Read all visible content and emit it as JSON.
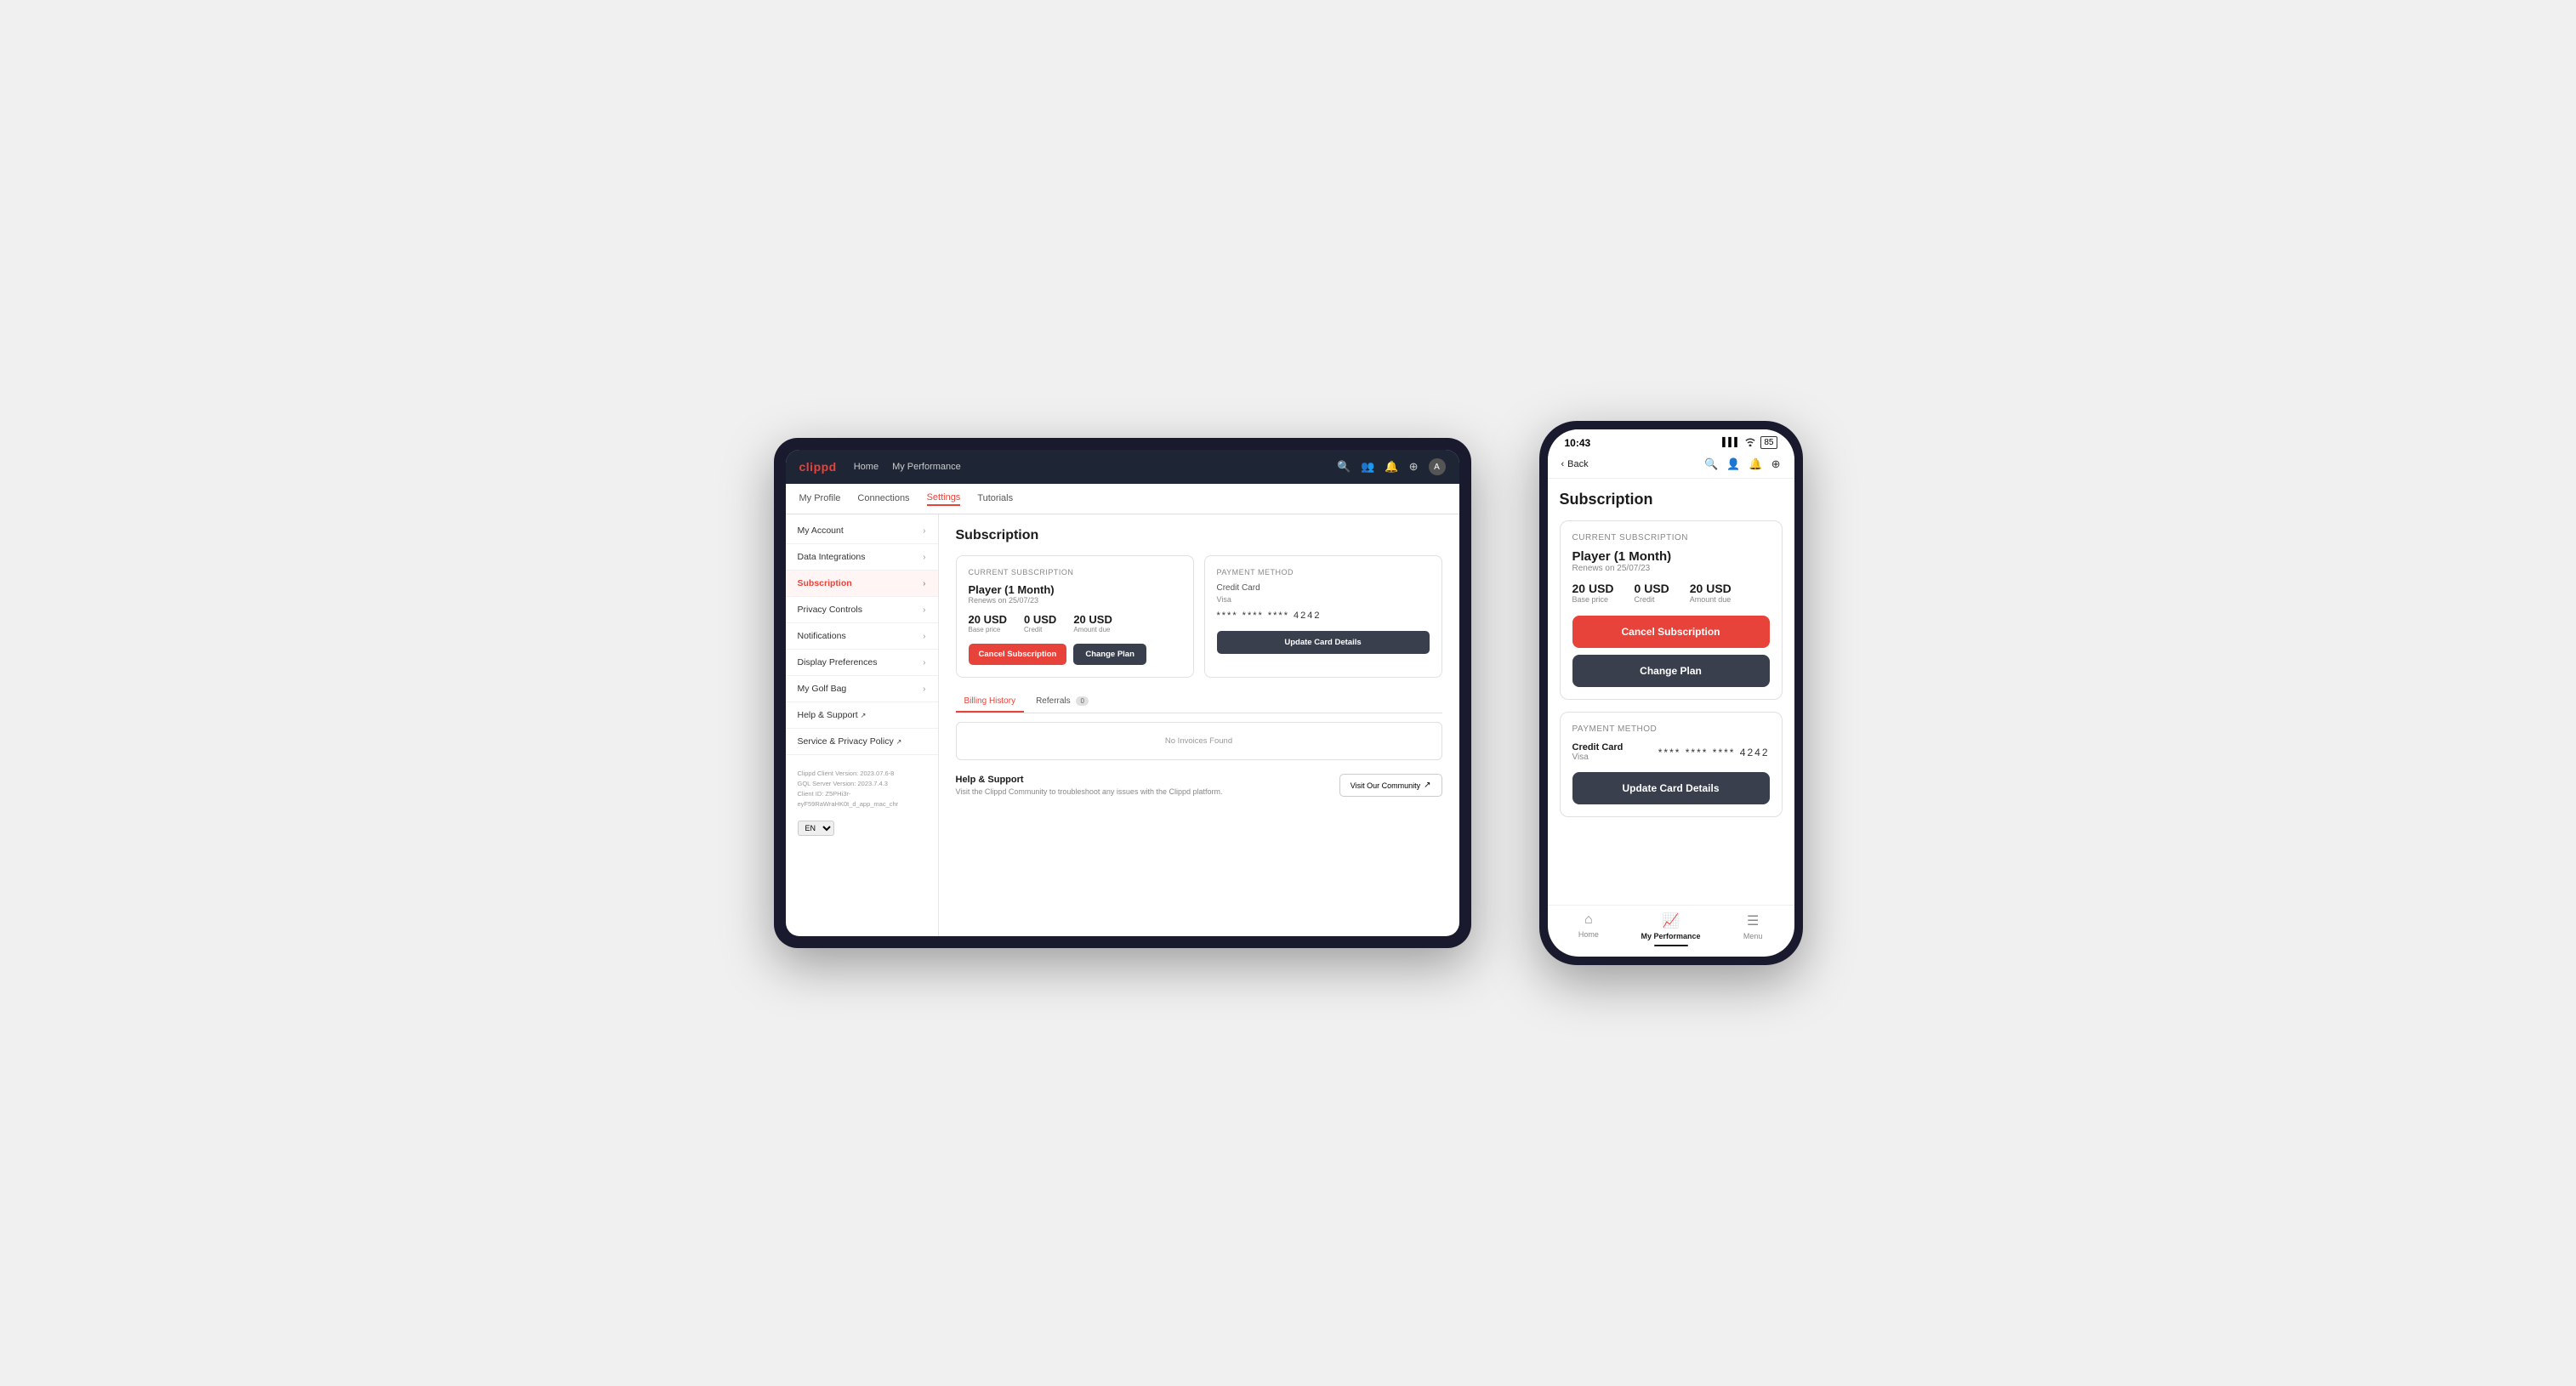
{
  "tablet": {
    "navbar": {
      "logo": "clippd",
      "nav_links": [
        "Home",
        "My Performance"
      ],
      "icons": [
        "🔍",
        "👥",
        "🔔",
        "⊕",
        "A"
      ]
    },
    "subnav": {
      "items": [
        "My Profile",
        "Connections",
        "Settings",
        "Tutorials"
      ],
      "active": "Settings"
    },
    "sidebar": {
      "items": [
        {
          "label": "My Account",
          "active": false
        },
        {
          "label": "Data Integrations",
          "active": false
        },
        {
          "label": "Subscription",
          "active": true
        },
        {
          "label": "Privacy Controls",
          "active": false
        },
        {
          "label": "Notifications",
          "active": false
        },
        {
          "label": "Display Preferences",
          "active": false
        },
        {
          "label": "My Golf Bag",
          "active": false
        },
        {
          "label": "Help & Support",
          "active": false,
          "ext": true
        },
        {
          "label": "Service & Privacy Policy",
          "active": false,
          "ext": true
        }
      ],
      "footer": {
        "client_version": "Clippd Client Version: 2023.07.6-8",
        "gql_version": "GQL Server Version: 2023.7.4.3",
        "client_id": "Client ID: Z5PHi3r-eyF59RaWraHK0t_d_app_mac_chr"
      },
      "lang": "EN"
    },
    "content": {
      "page_title": "Subscription",
      "current_subscription": {
        "card_title": "Current Subscription",
        "plan_name": "Player (1 Month)",
        "renews_on": "Renews on 25/07/23",
        "pricing": [
          {
            "value": "20 USD",
            "label": "Base price"
          },
          {
            "value": "0 USD",
            "label": "Credit"
          },
          {
            "value": "20 USD",
            "label": "Amount due"
          }
        ],
        "btn_cancel": "Cancel Subscription",
        "btn_change": "Change Plan"
      },
      "payment_method": {
        "card_title": "Payment Method",
        "type": "Credit Card",
        "brand": "Visa",
        "card_number": "**** **** **** 4242",
        "btn_update": "Update Card Details"
      },
      "billing": {
        "tabs": [
          {
            "label": "Billing History",
            "active": true,
            "badge": null
          },
          {
            "label": "Referrals",
            "active": false,
            "badge": "0"
          }
        ],
        "empty_message": "No Invoices Found"
      },
      "help_support": {
        "title": "Help & Support",
        "description": "Visit the Clippd Community to troubleshoot any issues with the Clippd platform.",
        "btn_label": "Visit Our Community"
      }
    }
  },
  "phone": {
    "status_bar": {
      "time": "10:43",
      "signal": "▌▌▌",
      "wifi": "WiFi",
      "battery": "85"
    },
    "header": {
      "back_label": "Back",
      "icons": [
        "🔍",
        "👤",
        "🔔",
        "⊕"
      ]
    },
    "content": {
      "page_title": "Subscription",
      "current_subscription": {
        "card_title": "Current Subscription",
        "plan_name": "Player (1 Month)",
        "renews_on": "Renews on 25/07/23",
        "pricing": [
          {
            "value": "20 USD",
            "label": "Base price"
          },
          {
            "value": "0 USD",
            "label": "Credit"
          },
          {
            "value": "20 USD",
            "label": "Amount due"
          }
        ],
        "btn_cancel": "Cancel Subscription",
        "btn_change": "Change Plan"
      },
      "payment_method": {
        "card_title": "Payment Method",
        "type": "Credit Card",
        "brand": "Visa",
        "card_number": "**** **** **** 4242",
        "btn_update": "Update Card Details"
      }
    },
    "bottom_nav": [
      {
        "label": "Home",
        "icon": "⌂",
        "active": false
      },
      {
        "label": "My Performance",
        "icon": "📈",
        "active": true
      },
      {
        "label": "Menu",
        "icon": "☰",
        "active": false
      }
    ]
  }
}
